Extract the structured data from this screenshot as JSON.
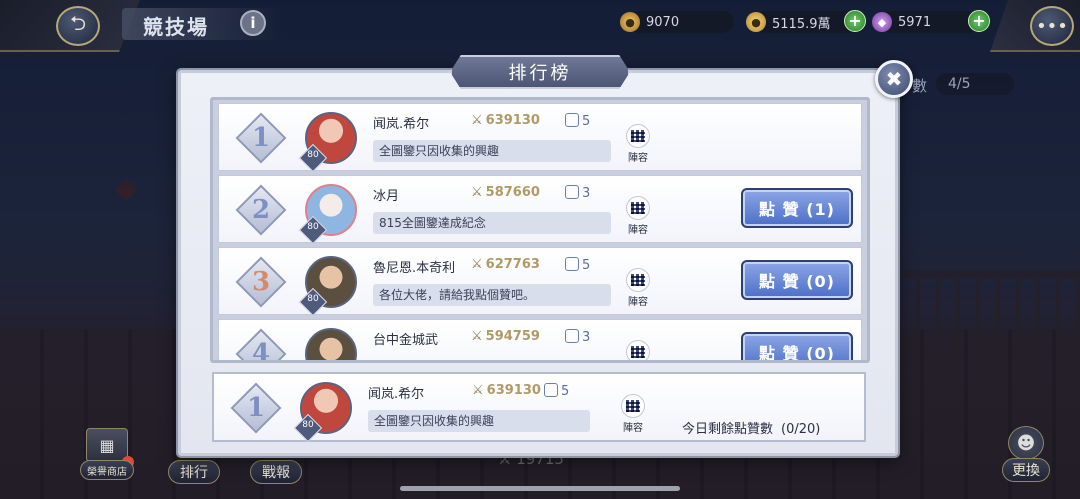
{
  "header": {
    "title": "競技場",
    "currencies": [
      {
        "icon": "medal-coin-icon",
        "value": "9070"
      },
      {
        "icon": "gold-coin-icon",
        "value": "5115.9萬"
      },
      {
        "icon": "gem-icon",
        "value": "5971"
      }
    ],
    "attempts_label": "數",
    "attempts_value": "4/5"
  },
  "background": {
    "shop_label": "榮譽商店",
    "rank_label": "排行",
    "report_label": "戰報",
    "switch_label": "更換",
    "power_value": "19715"
  },
  "modal": {
    "title": "排行榜",
    "lineup_label": "陣容",
    "rows": [
      {
        "rank": "1",
        "name": "闻岚.希尔",
        "power": "639130",
        "likes": "5",
        "motto": "全圖鑒只因收集的興趣",
        "level": "80",
        "avatar_color": "#c0473e",
        "like_button": ""
      },
      {
        "rank": "2",
        "name": "冰月",
        "power": "587660",
        "likes": "3",
        "motto": "815全圖鑒達成紀念",
        "level": "80",
        "avatar_color": "#8fb6e0",
        "like_button": "點 贊 (1)"
      },
      {
        "rank": "3",
        "name": "魯尼恩.本奇利",
        "power": "627763",
        "likes": "5",
        "motto": "各位大佬，請給我點個贊吧。",
        "level": "80",
        "avatar_color": "#5b5040",
        "like_button": "點 贊 (0)"
      },
      {
        "rank": "4",
        "name": "台中金城武",
        "power": "594759",
        "likes": "3",
        "motto": "",
        "level": "80",
        "avatar_color": "#5b5040",
        "like_button": "點 贊 (0)"
      }
    ],
    "my_row": {
      "rank": "1",
      "name": "闻岚.希尔",
      "power": "639130",
      "likes": "5",
      "motto": "全圖鑒只因收集的興趣",
      "level": "80",
      "avatar_color": "#c0473e",
      "remaining_label": "今日剩餘點贊數",
      "remaining_value": "(0/20)"
    }
  }
}
